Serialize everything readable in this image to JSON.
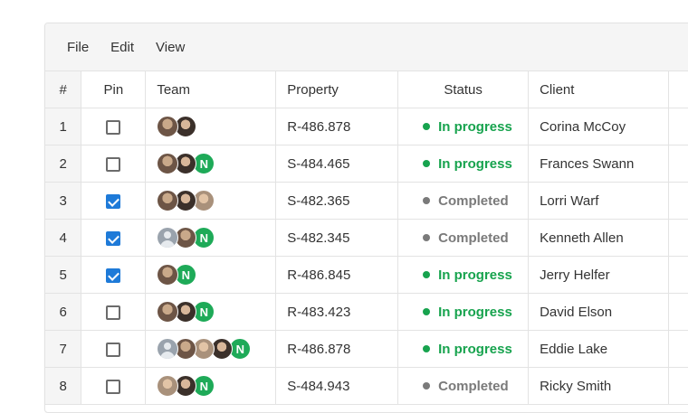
{
  "menu": [
    "File",
    "Edit",
    "View"
  ],
  "columns": {
    "num": "#",
    "pin": "Pin",
    "team": "Team",
    "property": "Property",
    "status": "Status",
    "client": "Client"
  },
  "colors": {
    "in_progress": "#17a34e",
    "completed": "#7a7a7a",
    "checkbox_checked": "#1e7ad8",
    "avatar_letter_bg": "#1eaa58"
  },
  "rows": [
    {
      "num": "1",
      "pinned": false,
      "team": [
        "avatar-woman-photo",
        "avatar-man-photo"
      ],
      "property": "R-486.878",
      "status": "In progress",
      "client": "Corina McCoy"
    },
    {
      "num": "2",
      "pinned": false,
      "team": [
        "avatar-woman-photo",
        "avatar-man-photo",
        "N"
      ],
      "property": "S-484.465",
      "status": "In progress",
      "client": "Frances Swann"
    },
    {
      "num": "3",
      "pinned": true,
      "team": [
        "avatar-woman-photo",
        "avatar-man-photo",
        "avatar-man-photo"
      ],
      "property": "S-482.365",
      "status": "Completed",
      "client": "Lorri Warf"
    },
    {
      "num": "4",
      "pinned": true,
      "team": [
        "avatar-placeholder",
        "avatar-woman-photo",
        "N"
      ],
      "property": "S-482.345",
      "status": "Completed",
      "client": "Kenneth Allen"
    },
    {
      "num": "5",
      "pinned": true,
      "team": [
        "avatar-woman-photo",
        "N"
      ],
      "property": "R-486.845",
      "status": "In progress",
      "client": "Jerry Helfer"
    },
    {
      "num": "6",
      "pinned": false,
      "team": [
        "avatar-woman-photo",
        "avatar-man-photo",
        "N"
      ],
      "property": "R-483.423",
      "status": "In progress",
      "client": "David Elson"
    },
    {
      "num": "7",
      "pinned": false,
      "team": [
        "avatar-placeholder",
        "avatar-woman-photo",
        "avatar-man-photo",
        "avatar-man-photo",
        "N"
      ],
      "property": "R-486.878",
      "status": "In progress",
      "client": "Eddie Lake"
    },
    {
      "num": "8",
      "pinned": false,
      "team": [
        "avatar-man-photo",
        "avatar-man-photo",
        "N"
      ],
      "property": "S-484.943",
      "status": "Completed",
      "client": "Ricky Smith"
    }
  ]
}
